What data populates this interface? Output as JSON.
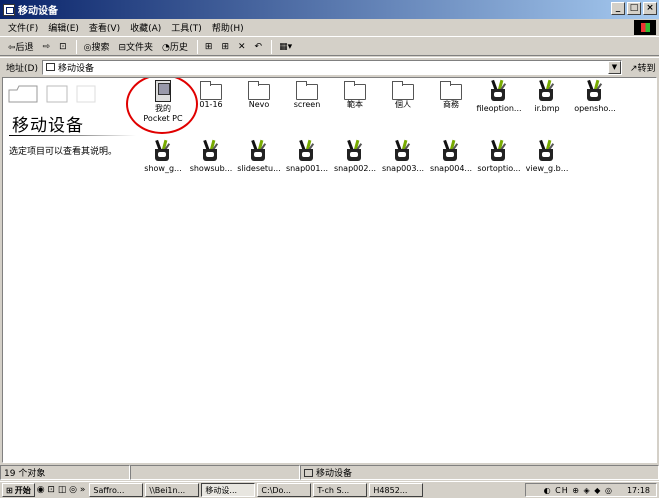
{
  "window": {
    "title": "移动设备",
    "buttons": {
      "minimize": "_",
      "maximize": "□",
      "close": "×"
    }
  },
  "menu": [
    "文件(F)",
    "编辑(E)",
    "查看(V)",
    "收藏(A)",
    "工具(T)",
    "帮助(H)"
  ],
  "toolbar": {
    "back": "⇦后退",
    "forward": "⇨",
    "up": "⊡",
    "search": "◎搜索",
    "folders": "⊟文件夹",
    "history": "◔历史",
    "move": "⊞",
    "copy": "⊞",
    "delete": "✕",
    "undo": "↶",
    "views": "▦▾"
  },
  "address": {
    "label": "地址(D)",
    "value": "移动设备",
    "go": "↗转到"
  },
  "left_pane": {
    "title": "移动设备",
    "description": "选定项目可以查看其说明。"
  },
  "items_row1": [
    {
      "label": "我的\nPocket PC",
      "icon": "pocket-pc-icon"
    },
    {
      "label": "01-16",
      "icon": "folder-icon"
    },
    {
      "label": "Nevo",
      "icon": "folder-icon"
    },
    {
      "label": "screen",
      "icon": "folder-icon"
    },
    {
      "label": "範本",
      "icon": "folder-icon"
    },
    {
      "label": "個人",
      "icon": "folder-icon"
    },
    {
      "label": "商務",
      "icon": "folder-icon"
    },
    {
      "label": "fileoption...",
      "icon": "image-file-icon"
    },
    {
      "label": "ir.bmp",
      "icon": "image-file-icon"
    },
    {
      "label": "opensho...",
      "icon": "image-file-icon"
    }
  ],
  "items_row2": [
    {
      "label": "show_g...",
      "icon": "image-file-icon"
    },
    {
      "label": "showsub...",
      "icon": "image-file-icon"
    },
    {
      "label": "slidesetu...",
      "icon": "image-file-icon"
    },
    {
      "label": "snap001...",
      "icon": "image-file-icon"
    },
    {
      "label": "snap002...",
      "icon": "image-file-icon"
    },
    {
      "label": "snap003...",
      "icon": "image-file-icon"
    },
    {
      "label": "snap004...",
      "icon": "image-file-icon"
    },
    {
      "label": "sortoptio...",
      "icon": "image-file-icon"
    },
    {
      "label": "view_g.b...",
      "icon": "image-file-icon"
    }
  ],
  "status": {
    "count": "19 个对象",
    "location": "移动设备"
  },
  "taskbar": {
    "start": "开始",
    "quicklaunch": "◉ ⊡ ◫ ◎ »",
    "tasks": [
      "Saffro...",
      "\\\\Bei1n...",
      "移动设...",
      "C:\\Do...",
      "T-ch S...",
      "H4852..."
    ],
    "tray_icons": "◐ CH ⊕ ◈ ◆ ◎",
    "clock": "17:18"
  },
  "colors": {
    "titlebar_start": "#0a246a",
    "titlebar_end": "#a6caf0",
    "highlight_ring": "#e00000"
  }
}
